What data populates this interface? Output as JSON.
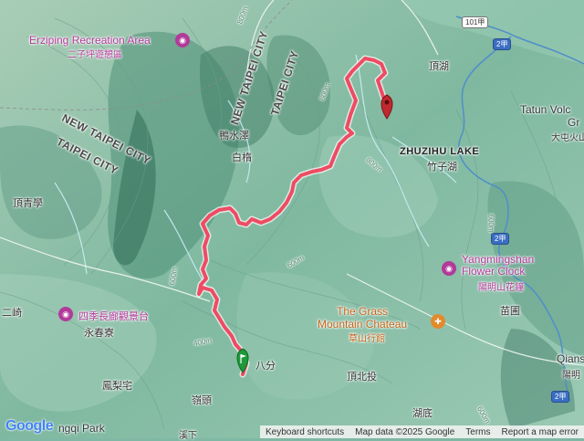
{
  "map": {
    "labels": {
      "erziping": "Erziping Recreation Area",
      "erziping_cn": "二子坪遊憩區",
      "new_taipei_city_1": "NEW TAIPEI CITY",
      "taipei_city_1": "TAIPEI CITY",
      "new_taipei_city_2": "NEW TAIPEI CITY",
      "taipei_city_2": "TAIPEI CITY",
      "yashuize": "鴨水澤",
      "baishu": "白楕",
      "dingqingxue": "頂青學",
      "sijizhang": "四季長廊觀景台",
      "yongchunliao": "永春寮",
      "fenglizhai": "鳳梨宅",
      "lingtou": "嶺頭",
      "bafen": "八分",
      "dingbeitou": "頂北投",
      "hudi": "湖底",
      "dinghu": "頂湖",
      "zhuzihu_lake": "ZHUZIHU LAKE",
      "zhuzihu_cn": "竹子湖",
      "tatun_volc": "Tatun Volc",
      "tatun_gr": "Gr",
      "datun_cn": "大屯火山",
      "flower_clock": "Yangmingshan\nFlower Clock",
      "flower_clock_cn": "陽明山花鐘",
      "grass_mountain": "The Grass\nMountain Chateau",
      "grass_mountain_cn": "草山行館",
      "miaopu": "苗圃",
      "qians": "Qians",
      "yangming_cn": "陽明",
      "erqi": "二崎",
      "xiapian": "溪下",
      "park": "ngqi Park"
    },
    "shields": {
      "road_101": "101甲",
      "road_2a_top": "2甲",
      "road_2a_mid": "2甲",
      "road_2a_bottom": "2甲"
    },
    "contours": [
      "800m",
      "800m",
      "800m",
      "600m",
      "600m",
      "400m",
      "600m",
      "600m"
    ],
    "colors": {
      "route": "#ef4b63",
      "route_outline": "#ffd6dc",
      "start_marker": "#1e9a3a",
      "end_marker": "#c0282f",
      "water": "#4f8ec9"
    }
  },
  "footer": {
    "google": "Google",
    "keyboard": "Keyboard shortcuts",
    "mapdata": "Map data ©2025 Google",
    "terms": "Terms",
    "report": "Report a map error"
  }
}
